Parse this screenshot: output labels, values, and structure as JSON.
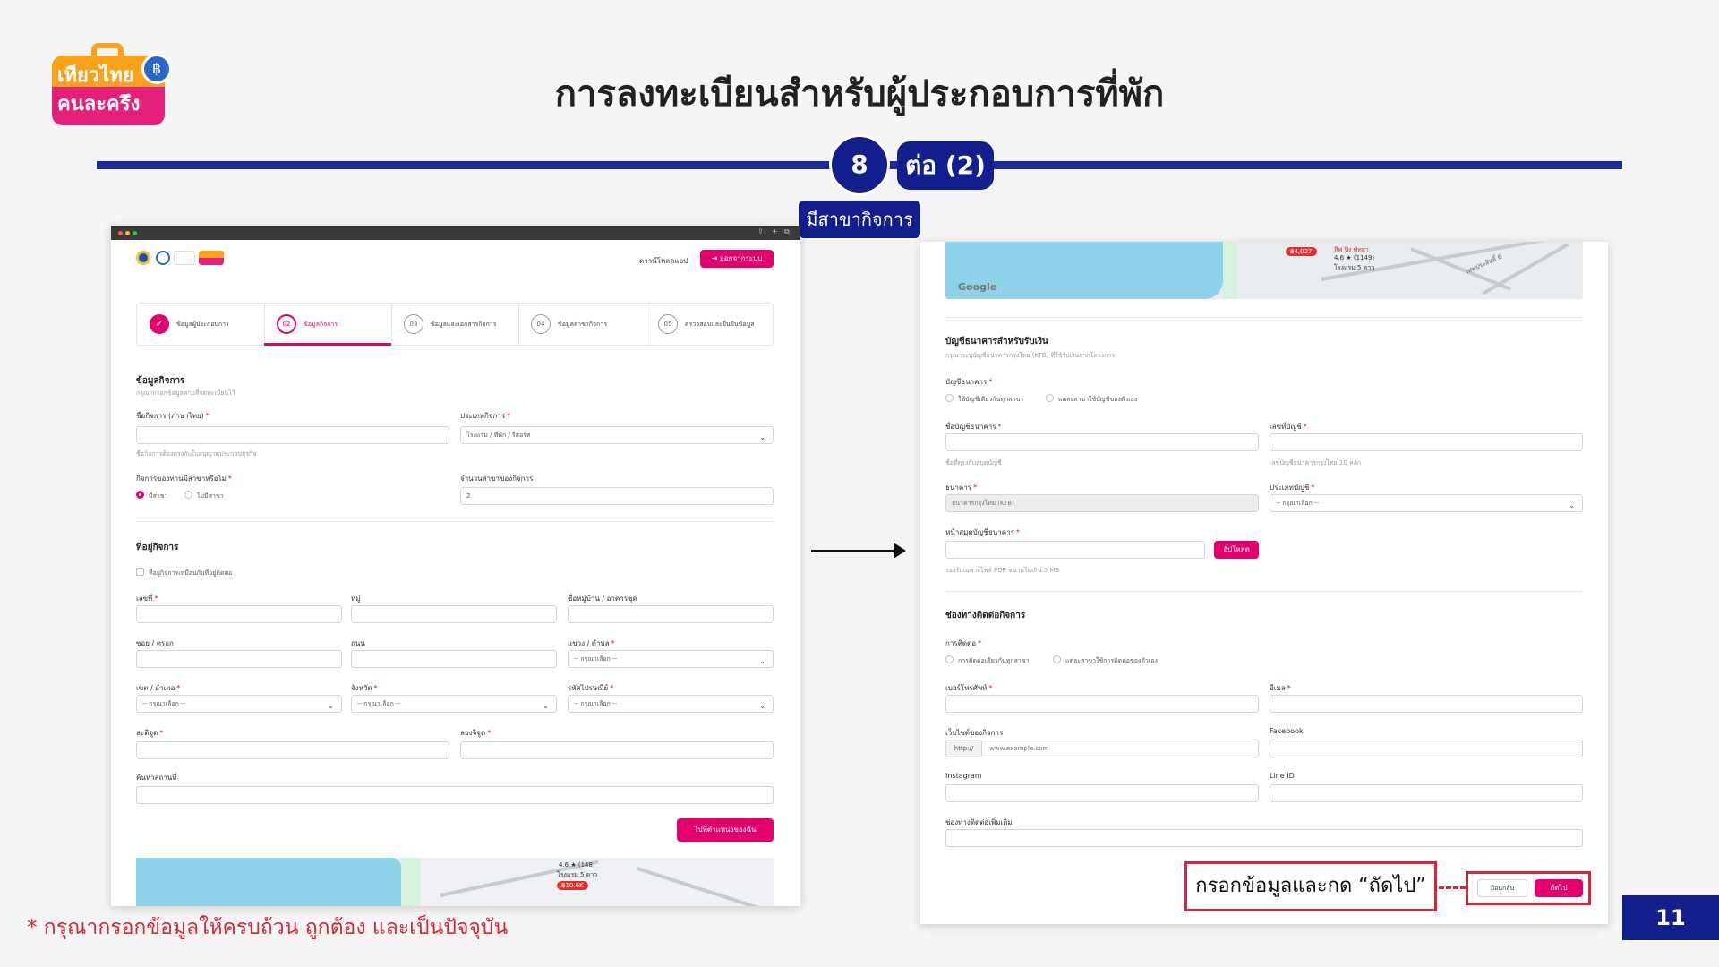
{
  "slide": {
    "logo_line1": "เที่ยวไทย",
    "logo_line2": "คนละครึ่ง",
    "title": "การลงทะเบียนสำหรับผู้ประกอบการที่พัก",
    "step_number": "8",
    "step_continuation": "ต่อ (2)",
    "step_caption": "มีสาขากิจการ",
    "footnote": "* กรุณากรอกข้อมูลให้ครบถ้วน ถูกต้อง และเป็นปัจจุบัน",
    "page_number": "11",
    "annotation": "กรอกข้อมูลและกด “ถัดไป”",
    "accent_color": "#121f8c",
    "brand_pink": "#e3006c",
    "annotation_color": "#d6263b"
  },
  "left_window": {
    "nav": {
      "download": "ดาวน์โหลดแอป",
      "logout": "ออกจากระบบ"
    },
    "steps": [
      {
        "num": "✓",
        "label": "ข้อมูลผู้ประกอบการ",
        "state": "done"
      },
      {
        "num": "02",
        "label": "ข้อมูลกิจการ",
        "state": "active"
      },
      {
        "num": "03",
        "label": "ข้อมูลและเอกสารกิจการ",
        "state": "todo"
      },
      {
        "num": "04",
        "label": "ข้อมูลสาขากิจการ",
        "state": "todo"
      },
      {
        "num": "05",
        "label": "ตรวจสอบและยืนยันข้อมูล",
        "state": "todo"
      }
    ],
    "business": {
      "heading": "ข้อมูลกิจการ",
      "subheading": "กรุณากรอกข้อมูลตามที่จดทะเบียนไว้",
      "name_label": "ชื่อกิจการ (ภาษาไทย)",
      "name_value": "",
      "name_hint": "ชื่อกิจการต้องตรงกับใบอนุญาตประกอบธุรกิจ",
      "type_label": "ประเภทกิจการ",
      "type_value": "โรงแรม / ที่พัก / รีสอร์ท",
      "branch_label": "กิจการของท่านมีสาขาหรือไม่",
      "branch_yes": "มีสาขา",
      "branch_no": "ไม่มีสาขา",
      "branch_count_label": "จำนวนสาขาของกิจการ",
      "branch_count_value": "2"
    },
    "address": {
      "heading": "ที่อยู่กิจการ",
      "same_as_contact": "ที่อยู่กิจการเหมือนกับที่อยู่ติดต่อ",
      "house_no": "เลขที่",
      "moo": "หมู่",
      "village": "ชื่อหมู่บ้าน / อาคารชุด",
      "soi": "ซอย / ตรอก",
      "road": "ถนน",
      "subdistrict": "แขวง / ตำบล",
      "district": "เขต / อำเภอ",
      "province": "จังหวัด",
      "postcode": "รหัสไปรษณีย์",
      "select_placeholder": "-- กรุณาเลือก --",
      "latitude": "ละติจูด",
      "longitude": "ลองจิจูด",
      "search_place": "ค้นหาสถานที่",
      "locate_button": "ไปที่ตำแหน่งของฉัน"
    },
    "map": {
      "price": "฿10.6K",
      "rating": "4.6 ★ (148)",
      "category": "โรงแรม 5 ดาว"
    }
  },
  "right_window": {
    "map": {
      "google": "Google",
      "price": "฿4,027",
      "hotel_name": "ลีฟ ปิง พัทยา",
      "rating": "4.6 ★ (1149)",
      "category": "โรงแรม 5 ดาว",
      "road": "เทพประสิทธิ์ 6"
    },
    "bank": {
      "heading": "บัญชีธนาคารสำหรับรับเงิน",
      "subheading": "กรุณาระบุบัญชีธนาคารกรุงไทย (KTB) ที่ใช้รับเงินจากโครงการ",
      "account_type_label": "บัญชีธนาคาร",
      "option_same": "ใช้บัญชีเดียวกันทุกสาขา",
      "option_separate": "แต่ละสาขาใช้บัญชีของตัวเอง",
      "account_name_label": "ชื่อบัญชีธนาคาร",
      "account_name_hint": "ชื่อที่ตรงกับสมุดบัญชี",
      "account_no_label": "เลขที่บัญชี",
      "account_no_hint": "เลขบัญชีธนาคารกรุงไทย 10 หลัก",
      "bank_label": "ธนาคาร",
      "bank_value": "ธนาคารกรุงไทย (KTB)",
      "acc_kind_label": "ประเภทบัญชี",
      "acc_kind_value": "-- กรุณาเลือก --",
      "book_label": "หน้าสมุดบัญชีธนาคาร",
      "upload_button": "อัปโหลด",
      "upload_hint": "รองรับเฉพาะไฟล์ PDF ขนาดไม่เกิน 5 MB"
    },
    "contact": {
      "heading": "ช่องทางติดต่อกิจการ",
      "contact_label": "การติดต่อ",
      "option_same": "การติดต่อเดียวกันทุกสาขา",
      "option_separate": "แต่ละสาขาใช้การติดต่อของตัวเอง",
      "phone_label": "เบอร์โทรศัพท์",
      "email_label": "อีเมล",
      "website_label": "เว็บไซต์ของกิจการ",
      "website_prefix": "http://",
      "website_placeholder": "www.example.com",
      "facebook_label": "Facebook",
      "instagram_label": "Instagram",
      "line_label": "Line ID",
      "extra_label": "ช่องทางติดต่อเพิ่มเติม"
    },
    "buttons": {
      "back": "ย้อนกลับ",
      "next": "ถัดไป"
    }
  }
}
